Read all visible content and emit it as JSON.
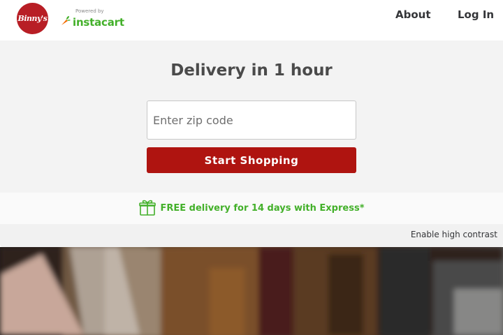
{
  "header": {
    "logo_text": "Binny's",
    "powered_by": "Powered by",
    "partner_name": "instacart",
    "nav": [
      {
        "label": "About"
      },
      {
        "label": "Log In"
      }
    ]
  },
  "hero": {
    "title": "Delivery in 1 hour",
    "zip_placeholder": "Enter zip code",
    "zip_value": "",
    "cta_label": "Start Shopping"
  },
  "promo": {
    "icon": "gift-icon",
    "text": "FREE delivery for 14 days with Express*"
  },
  "accessibility": {
    "contrast_label": "Enable high contrast"
  },
  "colors": {
    "brand_red": "#af1410",
    "instacart_green": "#43b02a",
    "instacart_orange": "#f36d00",
    "hero_bg": "#f3f3f3"
  }
}
